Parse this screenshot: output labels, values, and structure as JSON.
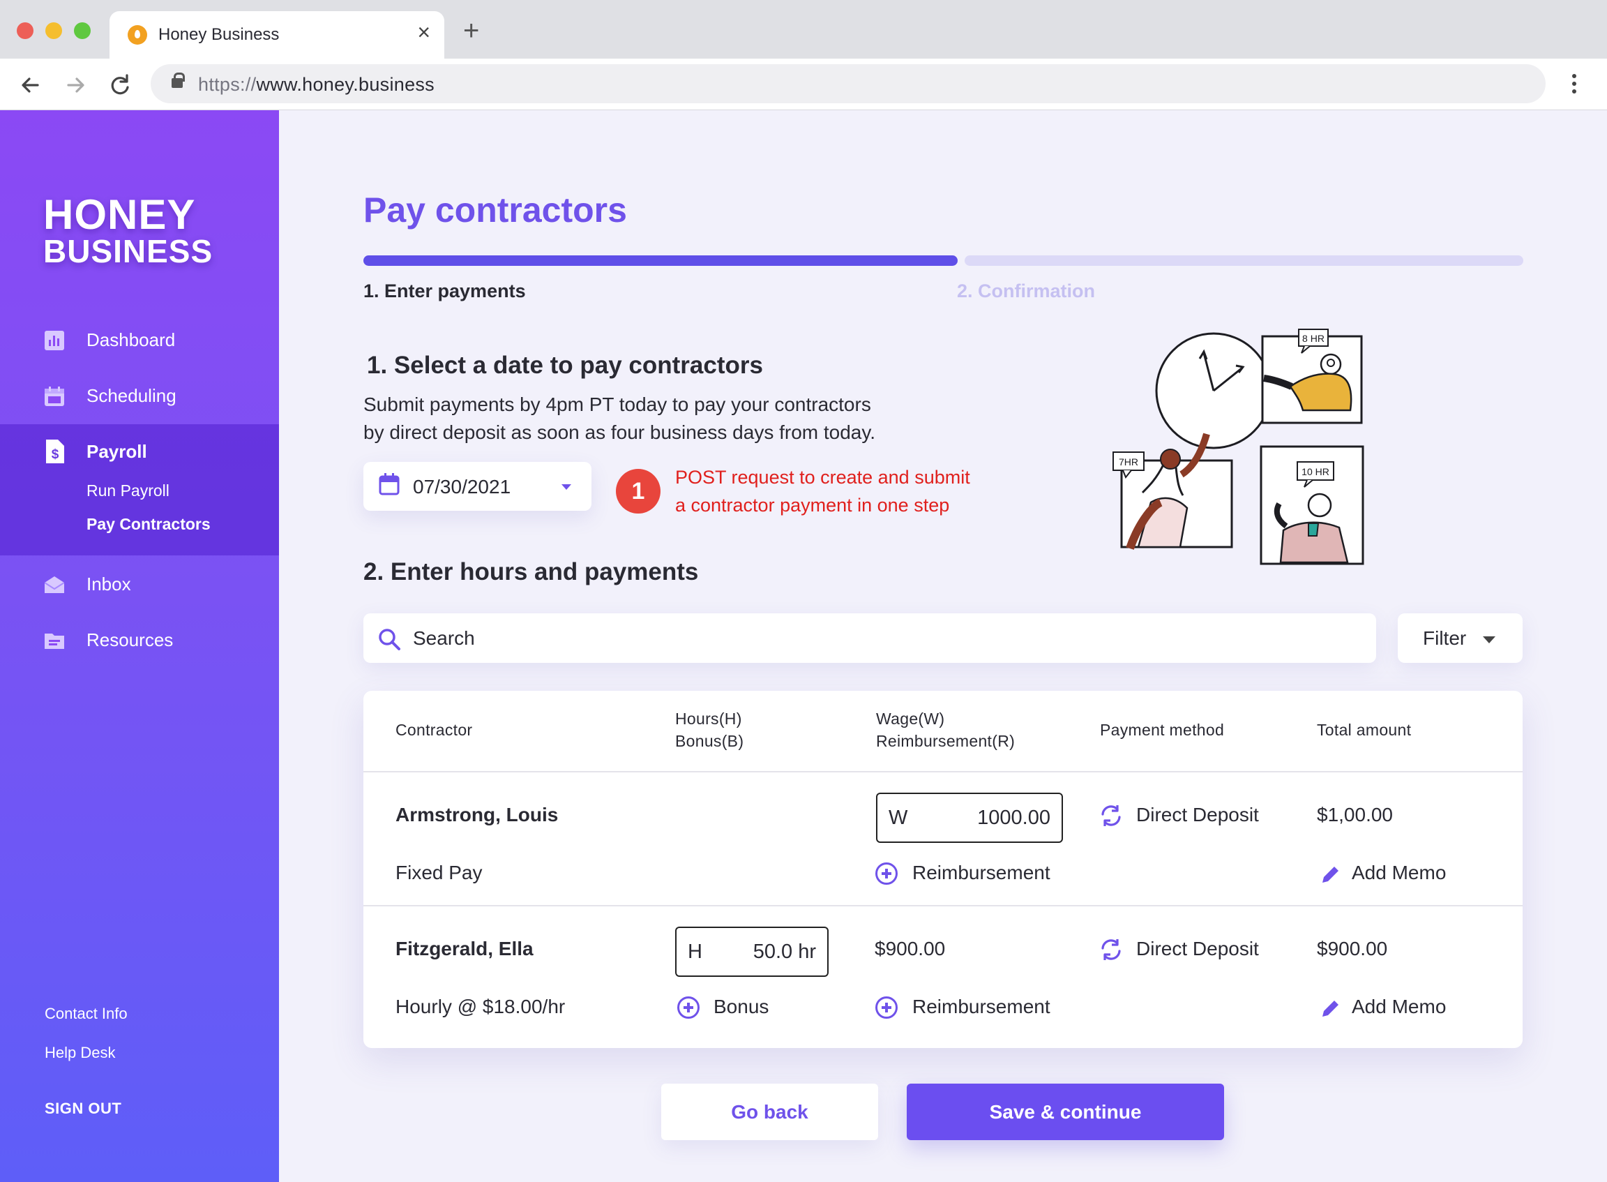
{
  "browser": {
    "tab_title": "Honey Business",
    "url_protocol": "https://",
    "url_host": "www.honey.business"
  },
  "sidebar": {
    "logo_line1": "HONEY",
    "logo_line2": "BUSINESS",
    "items": [
      {
        "label": "Dashboard",
        "icon": "bar-chart-icon"
      },
      {
        "label": "Scheduling",
        "icon": "calendar-icon"
      },
      {
        "label": "Payroll",
        "icon": "dollar-document-icon"
      },
      {
        "label": "Inbox",
        "icon": "envelope-icon"
      },
      {
        "label": "Resources",
        "icon": "folder-icon"
      }
    ],
    "payroll_sub": [
      "Run Payroll",
      "Pay Contractors"
    ],
    "footer": {
      "contact": "Contact Info",
      "help": "Help Desk",
      "signout": "SIGN OUT"
    }
  },
  "main": {
    "title": "Pay contractors",
    "progress": {
      "step1": "1. Enter payments",
      "step2": "2. Confirmation",
      "fraction_complete": 0.51
    },
    "section1": {
      "heading": "1. Select a date to pay contractors",
      "desc_line1": "Submit payments by 4pm PT today to pay your contractors",
      "desc_line2": "by direct deposit as soon as four business days from today.",
      "date_value": "07/30/2021",
      "badge": "1",
      "note_line1": "POST request to create and submit",
      "note_line2": "a contractor payment in one step"
    },
    "illustration": {
      "label_a": "8 HR",
      "label_b": "7HR",
      "label_c": "10 HR"
    },
    "section2": {
      "heading": "2. Enter hours and payments"
    },
    "search": {
      "placeholder": "Search"
    },
    "filter_label": "Filter",
    "table": {
      "headers": {
        "contractor": "Contractor",
        "hours_line1": "Hours(H)",
        "hours_line2": "Bonus(B)",
        "wage_line1": "Wage(W)",
        "wage_line2": "Reimbursement(R)",
        "method": "Payment method",
        "total": "Total amount"
      },
      "rows": [
        {
          "name": "Armstrong, Louis",
          "type": "Fixed Pay",
          "wage_prefix": "W",
          "wage_value": "1000.00",
          "reimbursement": "Reimbursement",
          "method": "Direct Deposit",
          "total": "$1,00.00",
          "memo": "Add Memo"
        },
        {
          "name": "Fitzgerald, Ella",
          "type": "Hourly @ $18.00/hr",
          "hours_prefix": "H",
          "hours_value": "50.0 hr",
          "bonus": "Bonus",
          "wage_amount": "$900.00",
          "reimbursement": "Reimbursement",
          "method": "Direct Deposit",
          "total": "$900.00",
          "memo": "Add Memo"
        }
      ]
    },
    "buttons": {
      "back": "Go back",
      "save": "Save & continue"
    }
  },
  "colors": {
    "accent": "#6f52ea",
    "danger": "#e8453c",
    "sidebar_top": "#8b49f4",
    "sidebar_bottom": "#5e5ef8"
  }
}
